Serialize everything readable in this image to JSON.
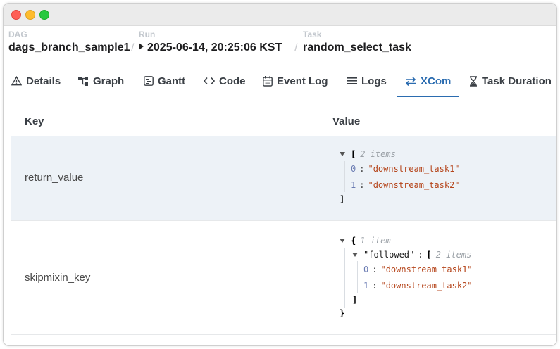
{
  "breadcrumb": {
    "dag": {
      "label": "DAG",
      "value": "dags_branch_sample1"
    },
    "run": {
      "label": "Run",
      "value": "2025-06-14, 20:25:06 KST"
    },
    "task": {
      "label": "Task",
      "value": "random_select_task"
    },
    "separator": "/"
  },
  "tabs": [
    {
      "label": "Details",
      "icon": "warning-triangle-icon"
    },
    {
      "label": "Graph",
      "icon": "graph-icon"
    },
    {
      "label": "Gantt",
      "icon": "gantt-icon"
    },
    {
      "label": "Code",
      "icon": "code-icon"
    },
    {
      "label": "Event Log",
      "icon": "calendar-icon"
    },
    {
      "label": "Logs",
      "icon": "list-icon"
    },
    {
      "label": "XCom",
      "icon": "arrows-exchange-icon",
      "active": true
    },
    {
      "label": "Task Duration",
      "icon": "hourglass-icon"
    }
  ],
  "table": {
    "headers": {
      "key": "Key",
      "value": "Value"
    },
    "rows": [
      {
        "key": "return_value",
        "value": {
          "open": "[",
          "meta": "2 items",
          "items": [
            {
              "index": "0",
              "value": "\"downstream_task1\""
            },
            {
              "index": "1",
              "value": "\"downstream_task2\""
            }
          ],
          "close": "]"
        }
      },
      {
        "key": "skipmixin_key",
        "value": {
          "open": "{",
          "meta": "1 item",
          "field": "\"followed\"",
          "field_open": "[",
          "field_meta": "2 items",
          "items": [
            {
              "index": "0",
              "value": "\"downstream_task1\""
            },
            {
              "index": "1",
              "value": "\"downstream_task2\""
            }
          ],
          "field_close": "]",
          "close": "}"
        }
      }
    ]
  },
  "colors": {
    "accent": "#2b6cb0",
    "row_shade": "#edf2f7",
    "json_string": "#b5451b"
  }
}
